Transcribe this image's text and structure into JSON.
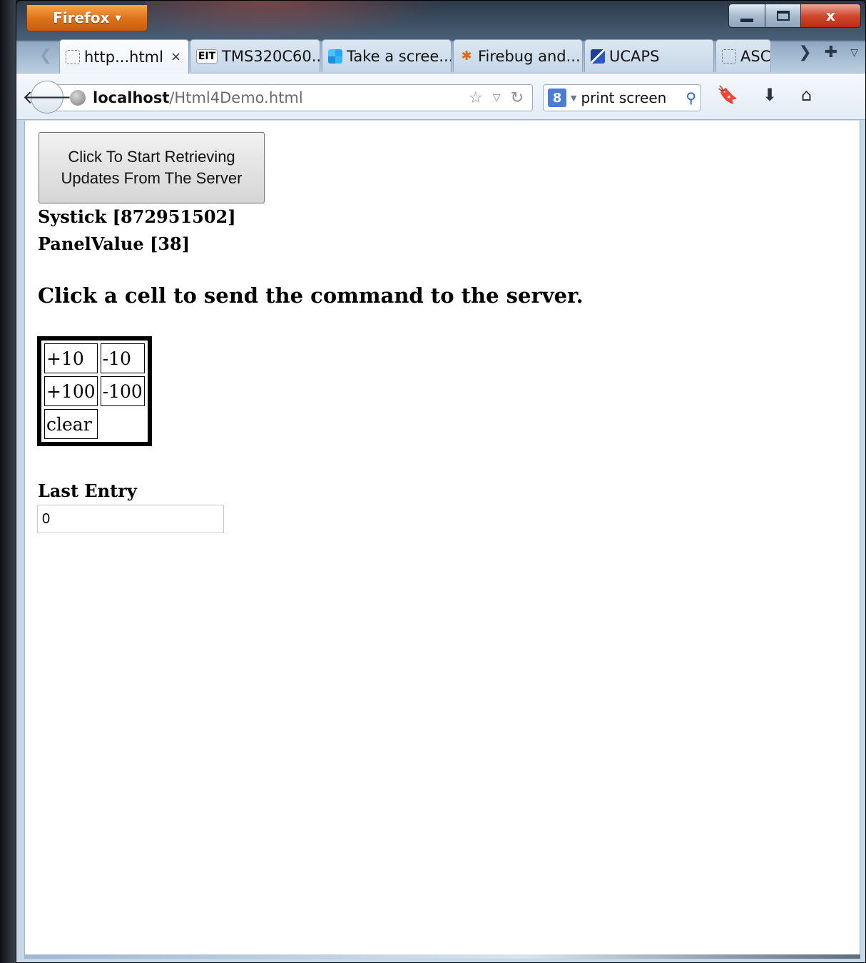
{
  "window": {
    "menu_button": "Firefox",
    "controls": {
      "close_glyph": "x"
    }
  },
  "tabs": [
    {
      "label": "http...html",
      "icon": "blank-page-icon",
      "active": true,
      "closable": true
    },
    {
      "label": "TMS320C60...",
      "icon": "eit-icon",
      "icon_text": "EIT"
    },
    {
      "label": "Take a scree...",
      "icon": "windows-icon"
    },
    {
      "label": "Firebug and...",
      "icon": "firebug-icon"
    },
    {
      "label": "UCAPS",
      "icon": "ucaps-icon"
    },
    {
      "label": "ASC",
      "icon": "blank-page-icon"
    }
  ],
  "nav": {
    "url_host": "localhost",
    "url_path": "/Html4Demo.html",
    "search_engine_letter": "8",
    "search_value": "print screen"
  },
  "page": {
    "start_button_label": "Click To Start Retrieving Updates From The Server",
    "systick_text": "Systick [872951502]",
    "panelvalue_text": "PanelValue [38]",
    "instructions": "Click a cell to send the command to the server.",
    "command_cells": [
      [
        "+10",
        "-10"
      ],
      [
        "+100",
        "-100"
      ],
      [
        "clear"
      ]
    ],
    "last_entry_label": "Last Entry",
    "last_entry_value": "0"
  },
  "colors": {
    "firefox_orange": "#e0741b",
    "close_red": "#d04a30",
    "content_bg": "#ffffff"
  }
}
